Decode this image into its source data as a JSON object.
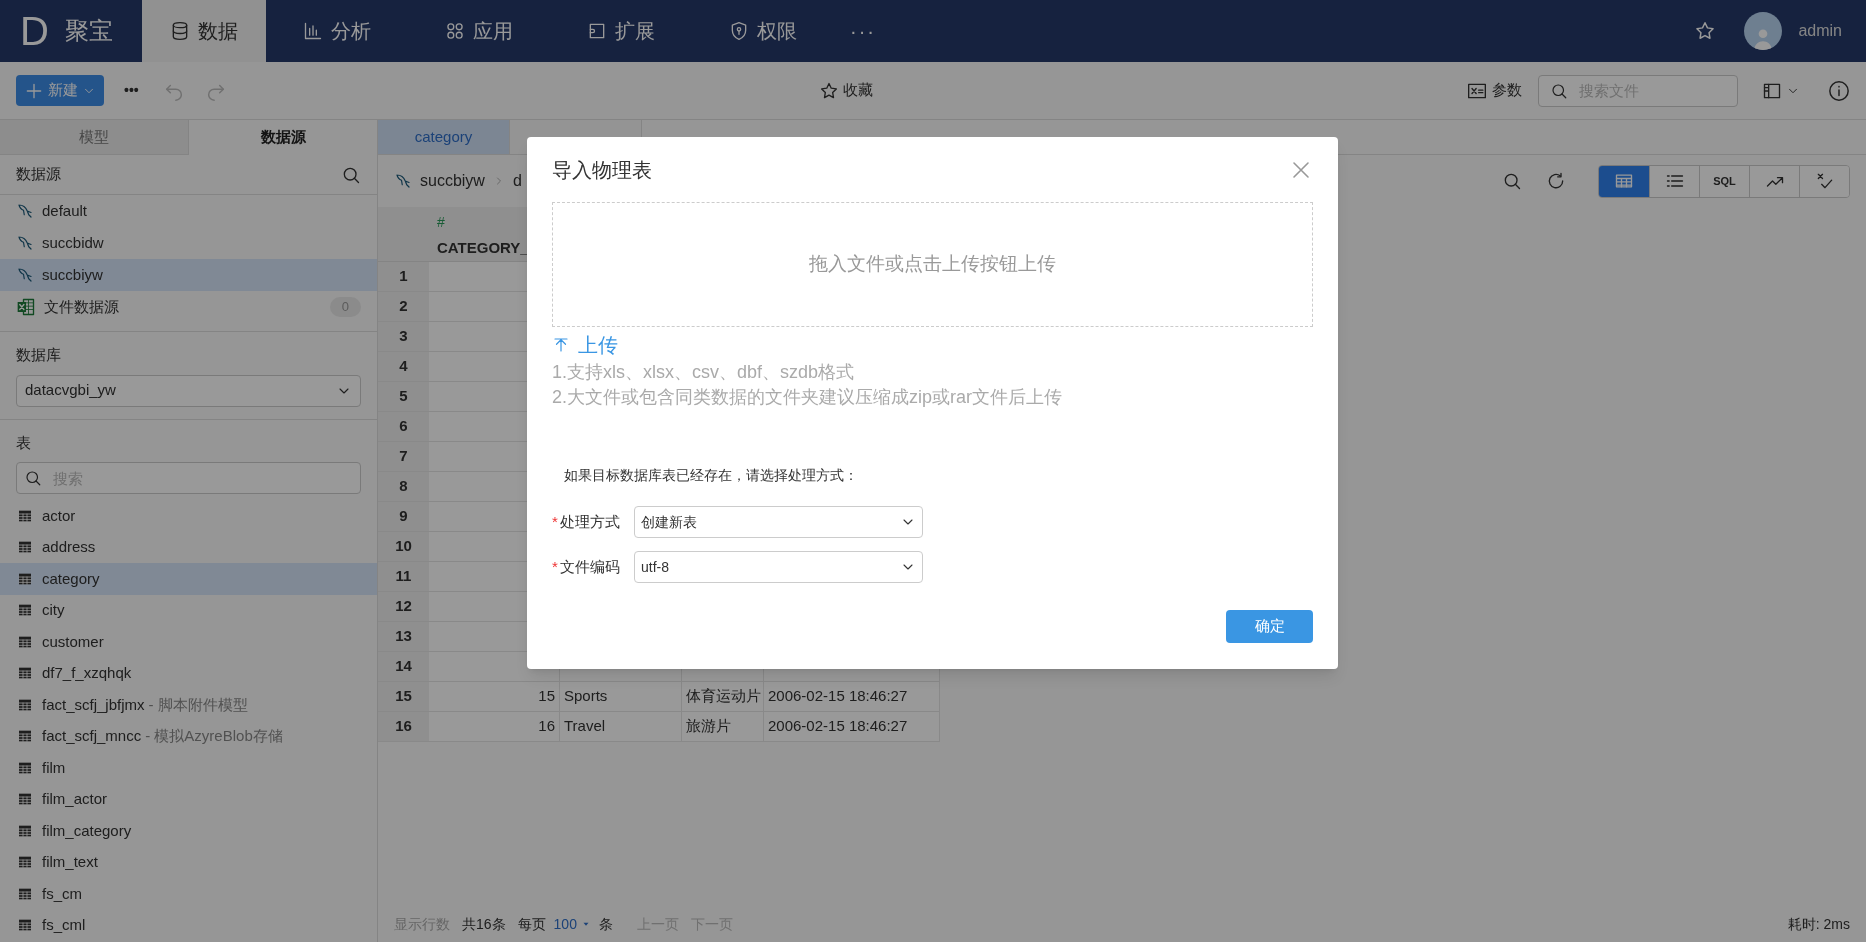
{
  "nav": {
    "logo": "D",
    "brand": "聚宝",
    "items": [
      {
        "label": "数据",
        "selected": true
      },
      {
        "label": "分析",
        "selected": false
      },
      {
        "label": "应用",
        "selected": false
      },
      {
        "label": "扩展",
        "selected": false
      },
      {
        "label": "权限",
        "selected": false
      }
    ],
    "more": "···",
    "user": "admin"
  },
  "toolbar": {
    "new_button": "新建",
    "more": "•••",
    "favorite": "收藏",
    "params": "参数",
    "search_placeholder": "搜索文件"
  },
  "sidebar": {
    "tabs": [
      {
        "label": "模型",
        "selected": false
      },
      {
        "label": "数据源",
        "selected": true
      }
    ],
    "datasource_title": "数据源",
    "datasources": [
      {
        "name": "default",
        "kind": "db",
        "selected": false
      },
      {
        "name": "succbidw",
        "kind": "db",
        "selected": false
      },
      {
        "name": "succbiyw",
        "kind": "db",
        "selected": true
      },
      {
        "name": "文件数据源",
        "kind": "file",
        "count": "0",
        "selected": false
      }
    ],
    "database_label": "数据库",
    "database": "datacvgbi_yw",
    "tables_label": "表",
    "table_search_placeholder": "搜索",
    "tables": [
      {
        "name": "actor",
        "selected": false
      },
      {
        "name": "address",
        "selected": false
      },
      {
        "name": "category",
        "selected": true
      },
      {
        "name": "city",
        "selected": false
      },
      {
        "name": "customer",
        "selected": false
      },
      {
        "name": "df7_f_xzqhqk",
        "selected": false
      },
      {
        "name": "fact_scfj_jbfjmx",
        "note": "- 脚本附件模型",
        "selected": false
      },
      {
        "name": "fact_scfj_mncc",
        "note": "- 模拟AzyreBlob存储",
        "selected": false
      },
      {
        "name": "film",
        "selected": false
      },
      {
        "name": "film_actor",
        "selected": false
      },
      {
        "name": "film_category",
        "selected": false
      },
      {
        "name": "film_text",
        "selected": false
      },
      {
        "name": "fs_cm",
        "selected": false
      },
      {
        "name": "fs_cml",
        "selected": false
      }
    ]
  },
  "main": {
    "tabs": [
      {
        "label": "category",
        "selected": true
      },
      {
        "selected": false
      }
    ],
    "breadcrumb": [
      "succbiyw",
      "d"
    ],
    "view_buttons": [
      {
        "kind": "table",
        "selected": true
      },
      {
        "kind": "list",
        "selected": false
      },
      {
        "kind": "sql",
        "label": "SQL",
        "selected": false
      },
      {
        "kind": "chart",
        "selected": false
      },
      {
        "kind": "check",
        "selected": false
      }
    ],
    "table": {
      "columns": [
        {
          "type_mark": "#",
          "name": "CATEGORY_"
        }
      ],
      "rows": [
        {
          "number": "1"
        },
        {
          "number": "2"
        },
        {
          "number": "3"
        },
        {
          "number": "4"
        },
        {
          "number": "5"
        },
        {
          "number": "6"
        },
        {
          "number": "7"
        },
        {
          "number": "8"
        },
        {
          "number": "9"
        },
        {
          "number": "10"
        },
        {
          "number": "11"
        },
        {
          "number": "12"
        },
        {
          "number": "13"
        },
        {
          "number": "14"
        },
        {
          "number": "15",
          "cells": [
            "15",
            "Sports",
            "体育运动片",
            "2006-02-15 18:46:27"
          ]
        },
        {
          "number": "16",
          "cells": [
            "16",
            "Travel",
            "旅游片",
            "2006-02-15 18:46:27"
          ]
        }
      ]
    },
    "footer": {
      "rows_label": "显示行数",
      "total": "共16条",
      "per_page": "每页",
      "page_size": "100",
      "unit": "条",
      "prev": "上一页",
      "next": "下一页",
      "elapsed": "耗时: 2ms"
    }
  },
  "dialog": {
    "title": "导入物理表",
    "dropzone": "拖入文件或点击上传按钮上传",
    "upload": "上传",
    "hints": [
      "1.支持xls、xlsx、csv、dbf、szdb格式",
      "2.大文件或包含同类数据的文件夹建议压缩成zip或rar文件后上传"
    ],
    "question": "如果目标数据库表已经存在，请选择处理方式：",
    "fields": [
      {
        "required_mark": "*",
        "label": "处理方式",
        "value": "创建新表"
      },
      {
        "required_mark": "*",
        "label": "文件编码",
        "value": "utf-8"
      }
    ],
    "confirm": "确定"
  }
}
